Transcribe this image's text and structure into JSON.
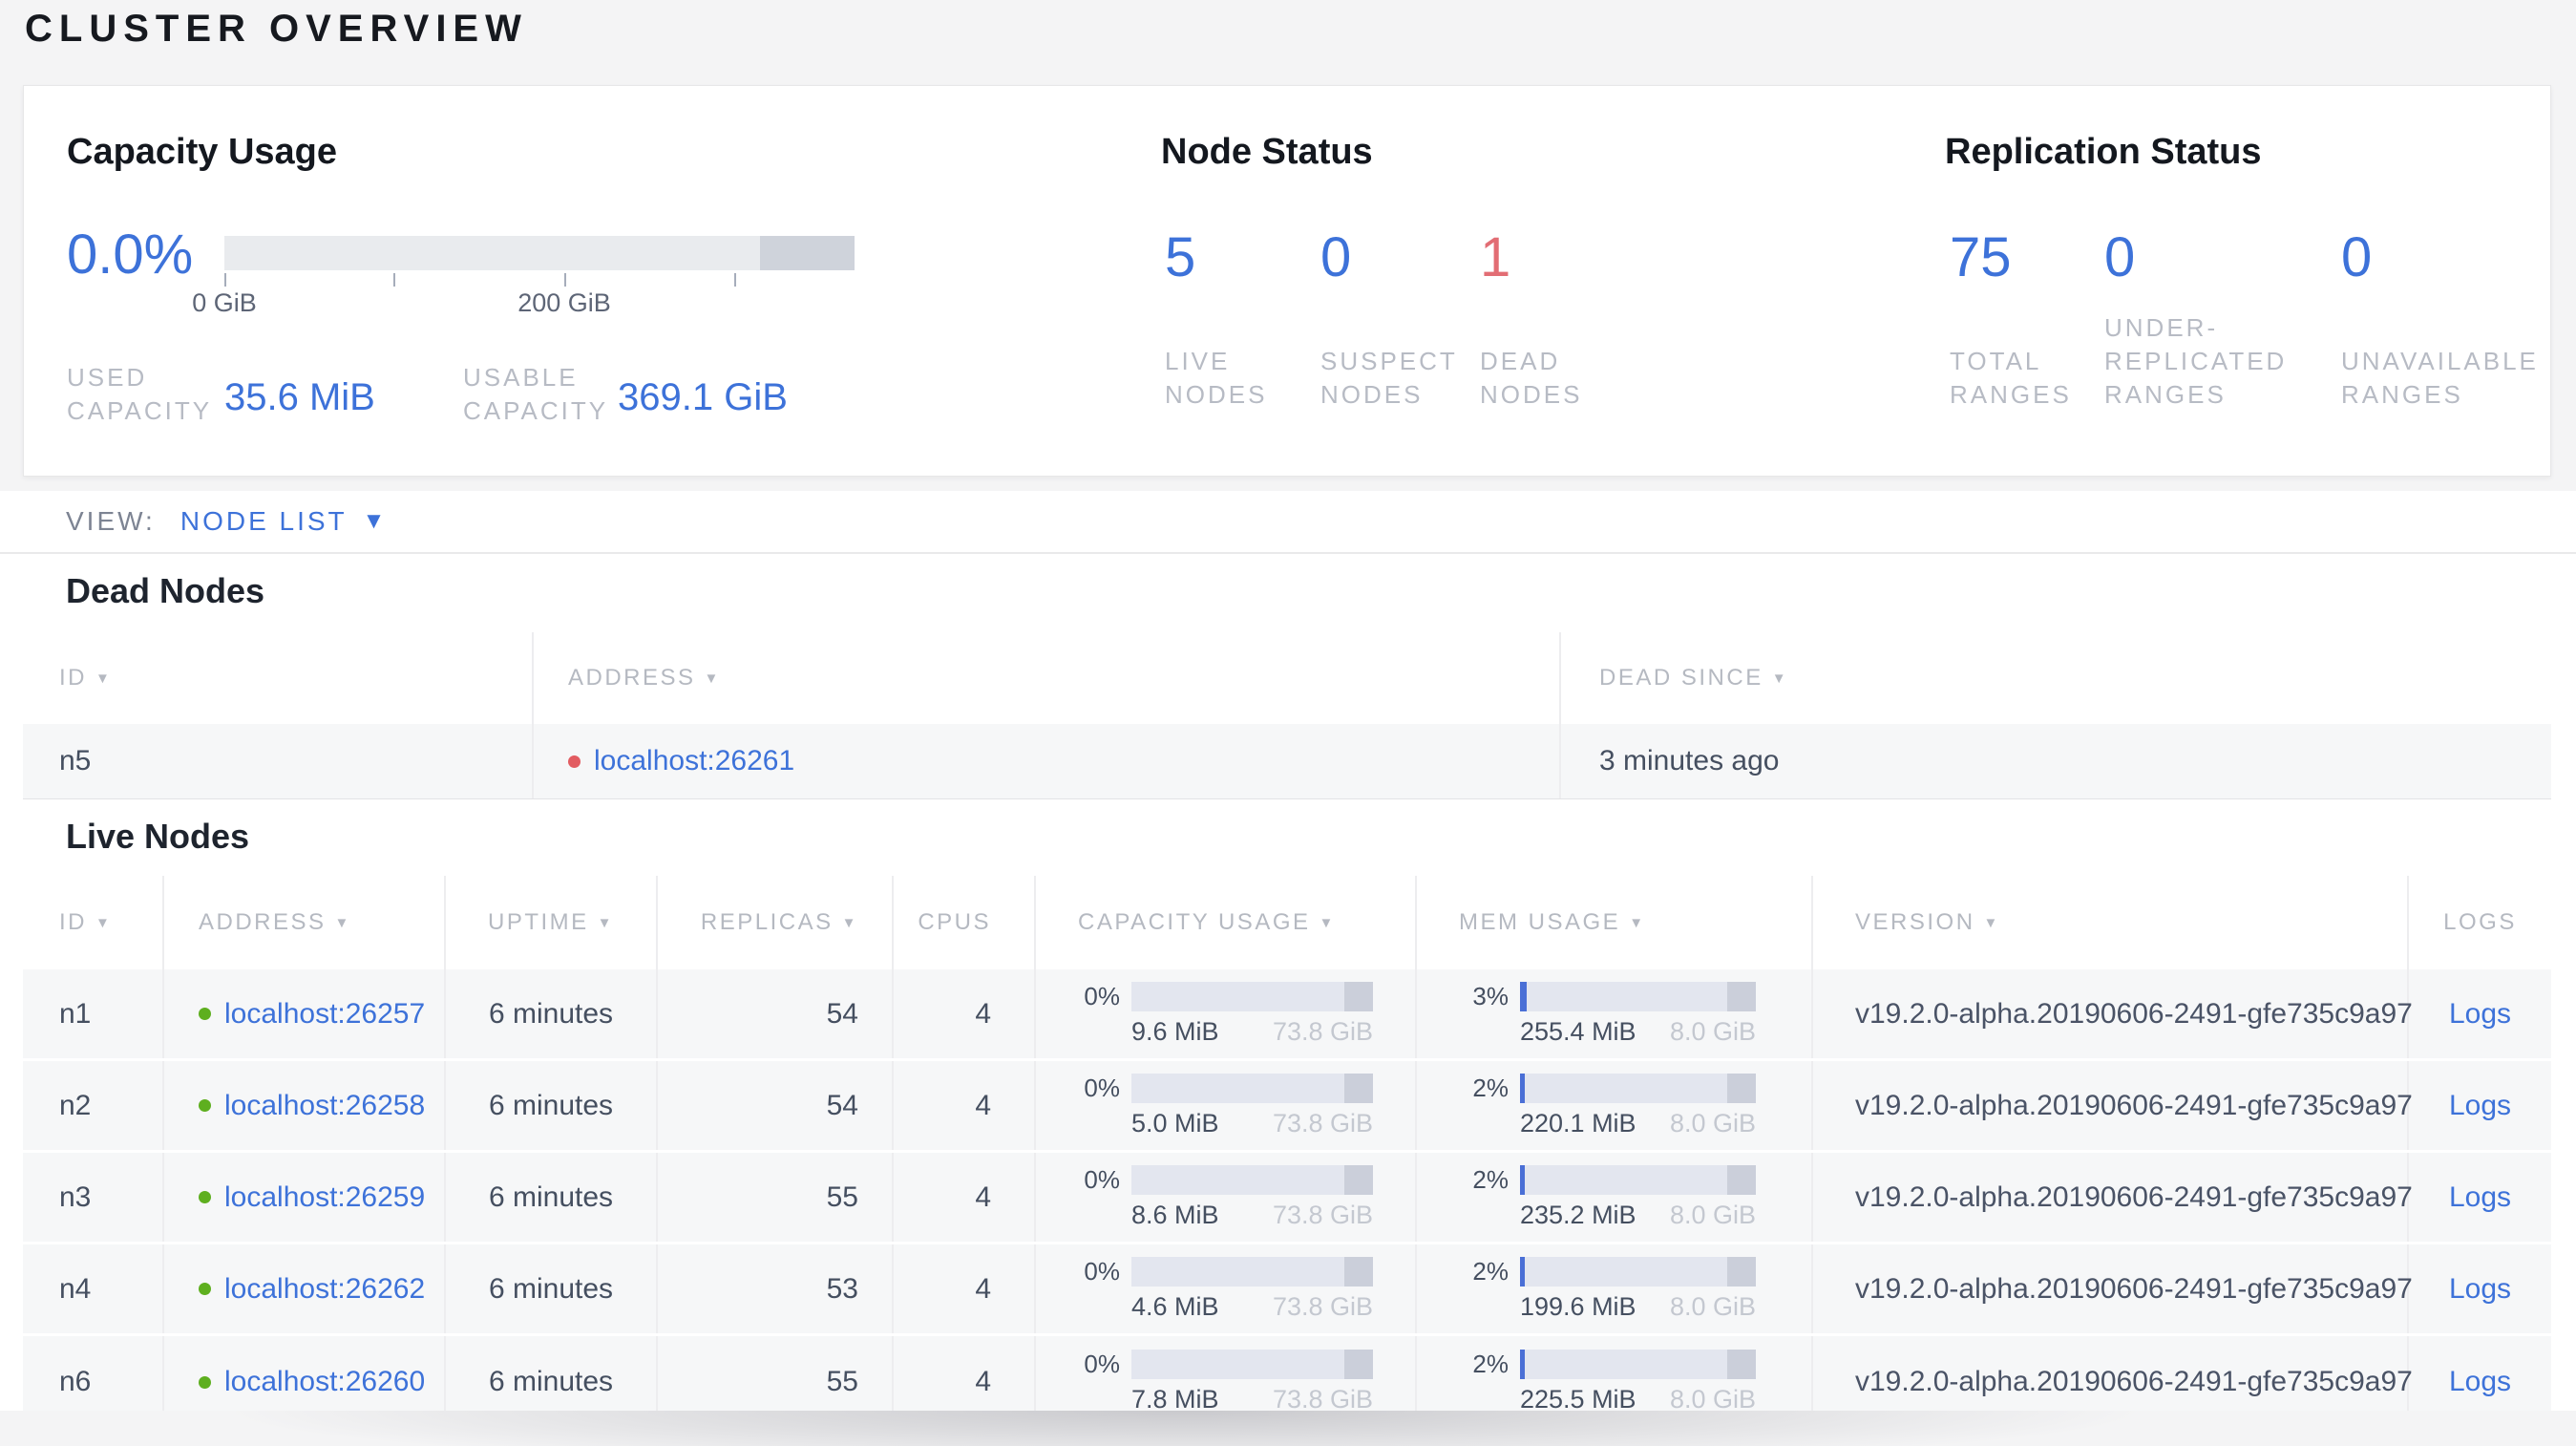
{
  "page": {
    "title": "CLUSTER OVERVIEW"
  },
  "icons": {
    "sort_arrow": "▼",
    "dropdown_caret": "▼"
  },
  "colors": {
    "accent_blue": "#3d72d9",
    "dead_red": "#e26d74",
    "live_dot_green": "#5eaf1f",
    "dead_dot_red": "#e25c61"
  },
  "summary": {
    "capacity": {
      "title": "Capacity Usage",
      "percent": "0.0%",
      "tick_labels": [
        "0 GiB",
        "200 GiB"
      ],
      "used_label": "USED CAPACITY",
      "used_value": "35.6 MiB",
      "usable_label": "USABLE CAPACITY",
      "usable_value": "369.1 GiB"
    },
    "node_status": {
      "title": "Node Status",
      "stats": [
        {
          "value": "5",
          "label": "LIVE NODES"
        },
        {
          "value": "0",
          "label": "SUSPECT NODES"
        },
        {
          "value": "1",
          "label": "DEAD NODES"
        }
      ]
    },
    "replication": {
      "title": "Replication Status",
      "stats": [
        {
          "value": "75",
          "label": "TOTAL RANGES"
        },
        {
          "value": "0",
          "label": "UNDER-REPLICATED RANGES"
        },
        {
          "value": "0",
          "label": "UNAVAILABLE RANGES"
        }
      ]
    }
  },
  "view_bar": {
    "label": "VIEW:",
    "selected": "NODE LIST"
  },
  "dead_nodes": {
    "heading": "Dead Nodes",
    "columns": [
      {
        "label": "ID"
      },
      {
        "label": "ADDRESS"
      },
      {
        "label": "DEAD SINCE"
      }
    ],
    "rows": [
      {
        "id": "n5",
        "address": "localhost:26261",
        "dead_since": "3 minutes ago"
      }
    ]
  },
  "live_nodes": {
    "heading": "Live Nodes",
    "logs_label": "Logs",
    "columns": [
      {
        "label": "ID"
      },
      {
        "label": "ADDRESS"
      },
      {
        "label": "UPTIME"
      },
      {
        "label": "REPLICAS"
      },
      {
        "label": "CPUS"
      },
      {
        "label": "CAPACITY USAGE"
      },
      {
        "label": "MEM USAGE"
      },
      {
        "label": "VERSION"
      },
      {
        "label": "LOGS"
      }
    ],
    "rows": [
      {
        "id": "n1",
        "address": "localhost:26257",
        "uptime": "6 minutes",
        "replicas": "54",
        "cpus": "4",
        "capacity": {
          "percent": "0%",
          "used": "9.6 MiB",
          "total": "73.8 GiB"
        },
        "mem": {
          "percent": "3%",
          "used": "255.4 MiB",
          "total": "8.0 GiB"
        },
        "version": "v19.2.0-alpha.20190606-2491-gfe735c9a97"
      },
      {
        "id": "n2",
        "address": "localhost:26258",
        "uptime": "6 minutes",
        "replicas": "54",
        "cpus": "4",
        "capacity": {
          "percent": "0%",
          "used": "5.0 MiB",
          "total": "73.8 GiB"
        },
        "mem": {
          "percent": "2%",
          "used": "220.1 MiB",
          "total": "8.0 GiB"
        },
        "version": "v19.2.0-alpha.20190606-2491-gfe735c9a97"
      },
      {
        "id": "n3",
        "address": "localhost:26259",
        "uptime": "6 minutes",
        "replicas": "55",
        "cpus": "4",
        "capacity": {
          "percent": "0%",
          "used": "8.6 MiB",
          "total": "73.8 GiB"
        },
        "mem": {
          "percent": "2%",
          "used": "235.2 MiB",
          "total": "8.0 GiB"
        },
        "version": "v19.2.0-alpha.20190606-2491-gfe735c9a97"
      },
      {
        "id": "n4",
        "address": "localhost:26262",
        "uptime": "6 minutes",
        "replicas": "53",
        "cpus": "4",
        "capacity": {
          "percent": "0%",
          "used": "4.6 MiB",
          "total": "73.8 GiB"
        },
        "mem": {
          "percent": "2%",
          "used": "199.6 MiB",
          "total": "8.0 GiB"
        },
        "version": "v19.2.0-alpha.20190606-2491-gfe735c9a97"
      },
      {
        "id": "n6",
        "address": "localhost:26260",
        "uptime": "6 minutes",
        "replicas": "55",
        "cpus": "4",
        "capacity": {
          "percent": "0%",
          "used": "7.8 MiB",
          "total": "73.8 GiB"
        },
        "mem": {
          "percent": "2%",
          "used": "225.5 MiB",
          "total": "8.0 GiB"
        },
        "version": "v19.2.0-alpha.20190606-2491-gfe735c9a97"
      }
    ]
  }
}
